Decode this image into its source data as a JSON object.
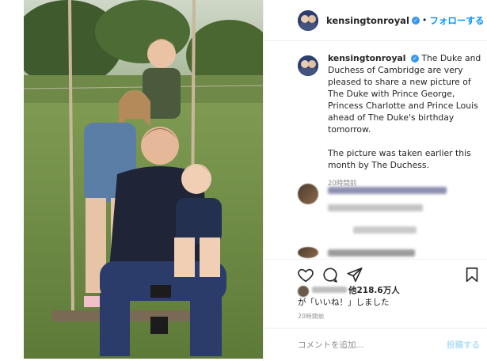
{
  "post": {
    "author": {
      "username": "kensingtonroyal",
      "verified_mark": "✓",
      "follow_label": "フォローする",
      "separator": "•"
    },
    "caption": {
      "text": "The Duke and Duchess of Cambridge are very pleased to share a new picture of The Duke with Prince George, Princess Charlotte and Prince Louis ahead of The Duke's birthday tomorrow.",
      "text2": "The picture was taken earlier this month by The Duchess.",
      "time": "20時間前"
    },
    "actions": {
      "like_icon": "heart-icon",
      "comment_icon": "comment-icon",
      "share_icon": "share-icon",
      "save_icon": "bookmark-icon"
    },
    "likes": {
      "count_text": "他218.6万人",
      "suffix_text": "が「いいね！」しました"
    },
    "timestamp": "20時間前",
    "comment_input": {
      "placeholder": "コメントを追加...",
      "submit_label": "投稿する"
    }
  },
  "colors": {
    "accent": "#0095f6",
    "verified": "#3897f0",
    "muted": "#8e8e8e",
    "post_disabled": "#b2dffc"
  }
}
